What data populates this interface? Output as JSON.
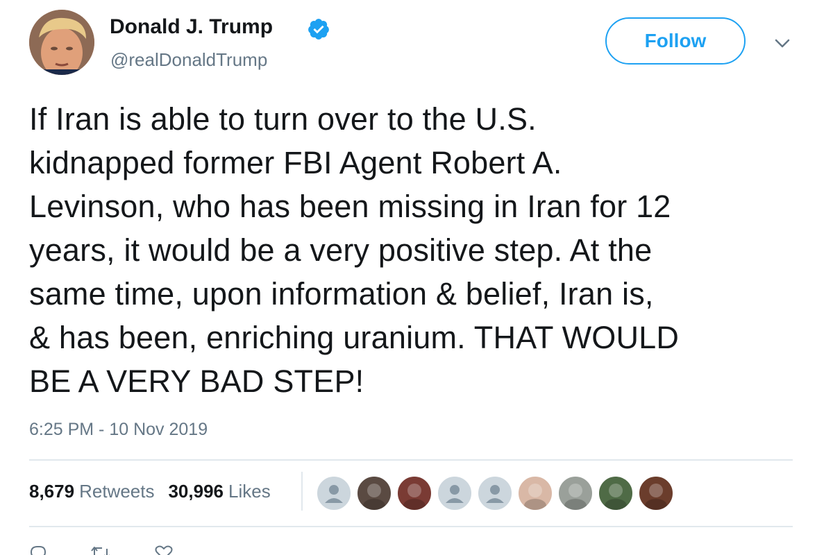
{
  "author": {
    "display_name": "Donald J. Trump",
    "handle": "@realDonaldTrump",
    "verified": true
  },
  "header": {
    "follow_label": "Follow"
  },
  "tweet": {
    "lines": [
      "If Iran is able to turn over to the U.S.",
      "kidnapped former FBI Agent Robert A.",
      "Levinson, who has been missing in Iran for 12",
      "years, it would be a very positive step. At the",
      "same time, upon information & belief, Iran is,",
      "& has been, enriching uranium. THAT WOULD",
      "BE A VERY BAD STEP!"
    ],
    "timestamp": "6:25 PM - 10 Nov 2019"
  },
  "stats": {
    "retweets_count": "8,679",
    "retweets_label": "Retweets",
    "likes_count": "30,996",
    "likes_label": "Likes"
  },
  "likers": [
    {
      "name": "default-avatar",
      "color": "#ccd6dd"
    },
    {
      "name": "dog-avatar",
      "color": "#5a4a42"
    },
    {
      "name": "flag-avatar",
      "color": "#7a3b34"
    },
    {
      "name": "default-avatar",
      "color": "#ccd6dd"
    },
    {
      "name": "default-avatar",
      "color": "#ccd6dd"
    },
    {
      "name": "photo-avatar",
      "color": "#d9b8a6"
    },
    {
      "name": "photo-avatar",
      "color": "#9aa09a"
    },
    {
      "name": "photo-avatar",
      "color": "#4f6b46"
    },
    {
      "name": "photo-avatar",
      "color": "#6b3d2c"
    }
  ],
  "colors": {
    "accent": "#1da1f2",
    "secondary_text": "#657786",
    "primary_text": "#14171a",
    "divider": "#e1e8ed"
  }
}
